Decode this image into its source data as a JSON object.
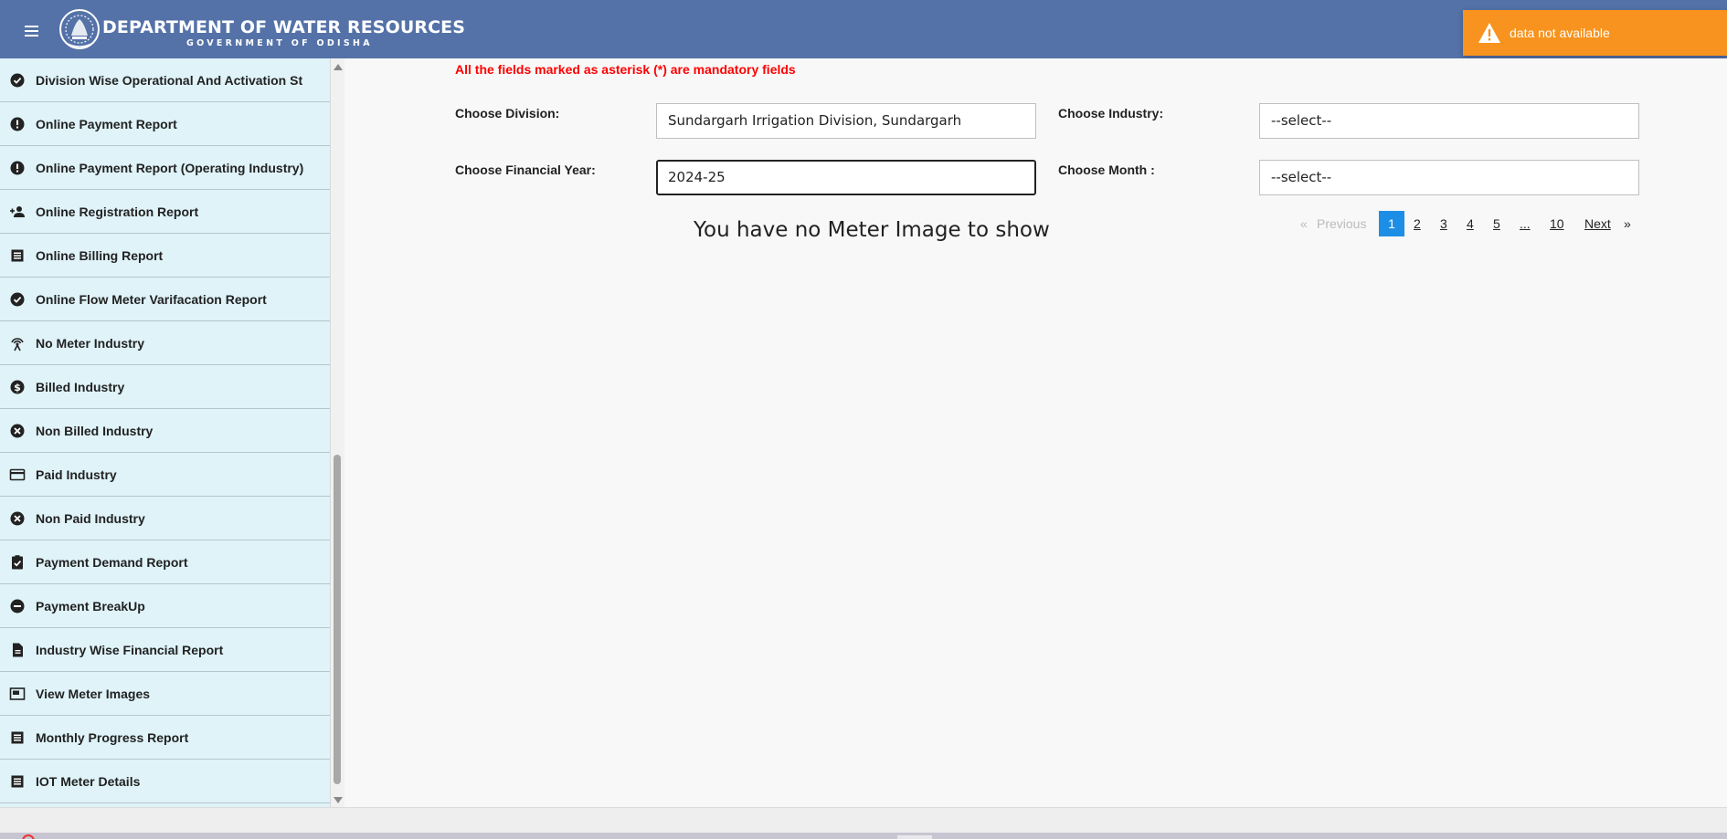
{
  "header": {
    "title": "DEPARTMENT OF WATER RESOURCES",
    "subtitle": "GOVERNMENT OF ODISHA",
    "bar_color": "#5472a8"
  },
  "toast": {
    "message": "data not available",
    "icon": "warning-icon",
    "color": "#f7931e"
  },
  "sidebar": {
    "background": "#dff3f8",
    "items": [
      {
        "label": "Division Wise Operational And Activation St",
        "icon": "check-circle-icon"
      },
      {
        "label": "Online Payment Report",
        "icon": "alert-circle-icon"
      },
      {
        "label": "Online Payment Report (Operating Industry)",
        "icon": "alert-circle-icon"
      },
      {
        "label": "Online Registration Report",
        "icon": "person-add-icon"
      },
      {
        "label": "Online Billing Report",
        "icon": "list-icon"
      },
      {
        "label": "Online Flow Meter Varifacation Report",
        "icon": "check-circle-icon"
      },
      {
        "label": "No Meter Industry",
        "icon": "broadcast-icon"
      },
      {
        "label": "Billed Industry",
        "icon": "dollar-circle-icon"
      },
      {
        "label": "Non Billed Industry",
        "icon": "cancel-circle-icon"
      },
      {
        "label": "Paid Industry",
        "icon": "credit-card-icon"
      },
      {
        "label": "Non Paid Industry",
        "icon": "cancel-circle-icon"
      },
      {
        "label": "Payment Demand Report",
        "icon": "clipboard-check-icon"
      },
      {
        "label": "Payment BreakUp",
        "icon": "minus-circle-icon"
      },
      {
        "label": "Industry Wise Financial Report",
        "icon": "document-icon"
      },
      {
        "label": "View Meter Images",
        "icon": "image-card-icon"
      },
      {
        "label": "Monthly Progress Report",
        "icon": "list-icon"
      },
      {
        "label": "IOT Meter Details",
        "icon": "list-icon"
      }
    ]
  },
  "form": {
    "mandatory_note": "All the fields marked as asterisk (*) are mandatory fields",
    "division_label": "Choose Division:",
    "division_value": "Sundargarh Irrigation Division, Sundargarh",
    "industry_label": "Choose Industry:",
    "industry_value": "--select--",
    "fy_label": "Choose Financial Year:",
    "fy_value": "2024-25",
    "month_label": "Choose Month :",
    "month_value": "--select--"
  },
  "empty_message": "You have no Meter Image to show",
  "pagination": {
    "prev_arrow": "«",
    "prev_label": "Previous",
    "pages": [
      "1",
      "2",
      "3",
      "4",
      "5",
      "...",
      "10"
    ],
    "current_page": "1",
    "next_label": "Next",
    "next_arrow": "»",
    "active_color": "#1d8ee6"
  }
}
